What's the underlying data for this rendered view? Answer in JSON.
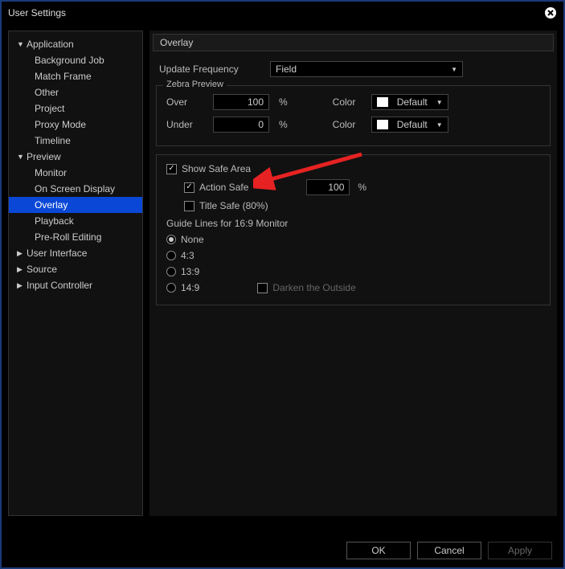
{
  "title": "User Settings",
  "sidebar": {
    "items": [
      {
        "label": "Application",
        "type": "group",
        "expanded": true
      },
      {
        "label": "Background Job",
        "type": "sub"
      },
      {
        "label": "Match Frame",
        "type": "sub"
      },
      {
        "label": "Other",
        "type": "sub"
      },
      {
        "label": "Project",
        "type": "sub"
      },
      {
        "label": "Proxy Mode",
        "type": "sub"
      },
      {
        "label": "Timeline",
        "type": "sub"
      },
      {
        "label": "Preview",
        "type": "group",
        "expanded": true
      },
      {
        "label": "Monitor",
        "type": "sub"
      },
      {
        "label": "On Screen Display",
        "type": "sub"
      },
      {
        "label": "Overlay",
        "type": "sub",
        "selected": true
      },
      {
        "label": "Playback",
        "type": "sub"
      },
      {
        "label": "Pre-Roll Editing",
        "type": "sub"
      },
      {
        "label": "User Interface",
        "type": "group",
        "expanded": false
      },
      {
        "label": "Source",
        "type": "group",
        "expanded": false
      },
      {
        "label": "Input Controller",
        "type": "group",
        "expanded": false
      }
    ]
  },
  "content": {
    "section": "Overlay",
    "update_frequency": {
      "label": "Update Frequency",
      "value": "Field"
    },
    "zebra": {
      "legend": "Zebra Preview",
      "over_label": "Over",
      "over_value": "100",
      "under_label": "Under",
      "under_value": "0",
      "pct": "%",
      "color_label": "Color",
      "over_color": "Default",
      "under_color": "Default"
    },
    "safe_area": {
      "show_label": "Show Safe Area",
      "show_checked": true,
      "action_label": "Action Safe",
      "action_checked": true,
      "action_value": "100",
      "pct": "%",
      "title_label": "Title Safe (80%)",
      "title_checked": false
    },
    "guidelines": {
      "heading": "Guide Lines for 16:9 Monitor",
      "options": [
        "None",
        "4:3",
        "13:9",
        "14:9"
      ],
      "selected": "None",
      "darken_label": "Darken the Outside",
      "darken_checked": false
    }
  },
  "footer": {
    "ok": "OK",
    "cancel": "Cancel",
    "apply": "Apply"
  }
}
